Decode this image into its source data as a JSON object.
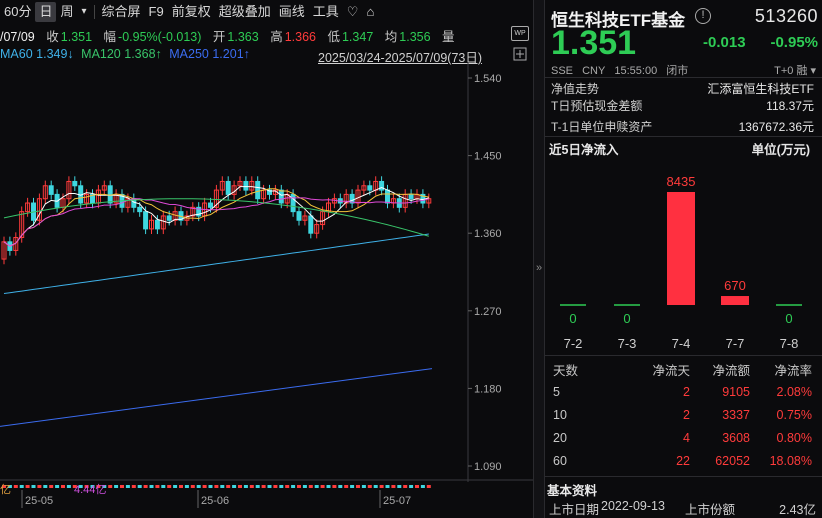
{
  "toolbar": {
    "items": [
      "60分",
      "日",
      "周",
      "▾",
      "综合屏",
      "F9",
      "前复权",
      "超级叠加",
      "画线",
      "工具",
      "♡",
      "⌂"
    ]
  },
  "info": {
    "date": "/07/09",
    "close_label": "收",
    "close": "1.351",
    "range_label": "幅",
    "range": "-0.95%(-0.013)",
    "open_label": "开",
    "open": "1.363",
    "high_label": "高",
    "high": "1.366",
    "low_label": "低",
    "low": "1.347",
    "avg_label": "均",
    "avg": "1.356",
    "vol_label": "量"
  },
  "ma": {
    "ma60_label": "MA60",
    "ma60": "1.349↓",
    "ma120_label": "MA120",
    "ma120": "1.368↑",
    "ma250_label": "MA250",
    "ma250": "1.201↑",
    "date_range": "2025/03/24-2025/07/09(73日)"
  },
  "axis": {
    "price_ticks": [
      "1.540",
      "1.450",
      "1.360",
      "1.270",
      "1.180",
      "1.090"
    ],
    "date_ticks": [
      "25-05",
      "25-06",
      "25-07"
    ],
    "volume_label": "亿",
    "volume_value": "4.44亿"
  },
  "fund": {
    "name": "恒生科技ETF基金",
    "code": "513260",
    "price": "1.351",
    "change": "-0.013",
    "change_pct": "-0.95%",
    "exchange": "SSE",
    "currency": "CNY",
    "time": "15:55:00",
    "status": "闭市",
    "tplus": "T+0 融 ▾"
  },
  "nav": {
    "label": "净值走势",
    "tracking": "汇添富恒生科技ETF",
    "cash_diff_label": "T日预估现金差额",
    "cash_diff": "118.37元",
    "unit_asset_label": "T-1日单位申赎资产",
    "unit_asset": "1367672.36元"
  },
  "flow": {
    "title": "近5日净流入",
    "unit": "单位(万元)"
  },
  "chart_data": {
    "type": "bar",
    "categories": [
      "7-2",
      "7-3",
      "7-4",
      "7-7",
      "7-8"
    ],
    "values": [
      0,
      0,
      8435,
      670,
      0
    ],
    "title": "近5日净流入",
    "ylabel": "单位(万元)"
  },
  "stats": {
    "headers": [
      "天数",
      "净流天",
      "净流额",
      "净流率"
    ],
    "rows": [
      [
        "5",
        "2",
        "9105",
        "2.08%"
      ],
      [
        "10",
        "2",
        "3337",
        "0.75%"
      ],
      [
        "20",
        "4",
        "3608",
        "0.80%"
      ],
      [
        "60",
        "22",
        "62052",
        "18.08%"
      ]
    ]
  },
  "basic": {
    "title": "基本资料",
    "listing_date_label": "上市日期",
    "listing_date": "2022-09-13",
    "listing_shares_label": "上市份额",
    "listing_shares": "2.43亿"
  },
  "colors": {
    "up": "#ff3b3b",
    "down": "#2ecc55",
    "ma5": "#ffffff",
    "ma10": "#f3c33a",
    "ma20": "#e04ad8",
    "ma60": "#3fb1e8",
    "ma120": "#39c46a",
    "ma250": "#3b6cf0"
  }
}
